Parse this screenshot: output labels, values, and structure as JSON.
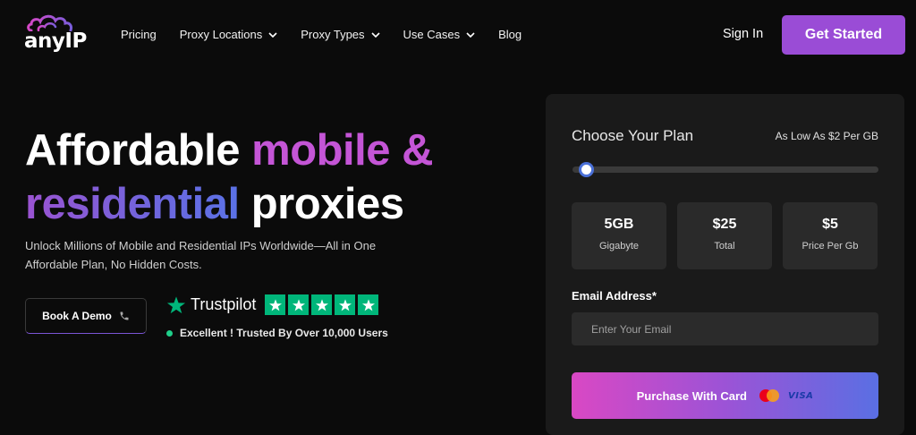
{
  "brand": {
    "logo_text": "anyIP",
    "accent": "#9a4cd6"
  },
  "nav": {
    "items": [
      {
        "label": "Pricing",
        "has_dropdown": false
      },
      {
        "label": "Proxy Locations",
        "has_dropdown": true
      },
      {
        "label": "Proxy Types",
        "has_dropdown": true
      },
      {
        "label": "Use Cases",
        "has_dropdown": true
      },
      {
        "label": "Blog",
        "has_dropdown": false
      }
    ],
    "signin_label": "Sign In",
    "get_started_label": "Get Started"
  },
  "hero": {
    "title_word1": "Affordable",
    "title_word2": "mobile &",
    "title_word3": "residential",
    "title_word4": "proxies",
    "subtitle": "Unlock Millions of Mobile and Residential IPs Worldwide—All in One Affordable Plan, No Hidden Costs.",
    "demo_label": "Book A Demo",
    "demo_icon": "phone-icon",
    "trustpilot_label": "Trustpilot",
    "trustpilot_stars": 5,
    "trust_text": "Excellent ! Trusted By Over 10,000 Users"
  },
  "plan": {
    "title": "Choose Your Plan",
    "note": "As Low As $2 Per GB",
    "slider_fraction": 0.02,
    "stats": [
      {
        "value": "5GB",
        "label": "Gigabyte"
      },
      {
        "value": "$25",
        "label": "Total"
      },
      {
        "value": "$5",
        "label": "Price Per Gb"
      }
    ],
    "email_label": "Email Address*",
    "email_placeholder": "Enter Your Email",
    "email_value": "",
    "purchase_label": "Purchase With Card",
    "card_brands": [
      "mastercard-icon",
      "VISA"
    ]
  }
}
